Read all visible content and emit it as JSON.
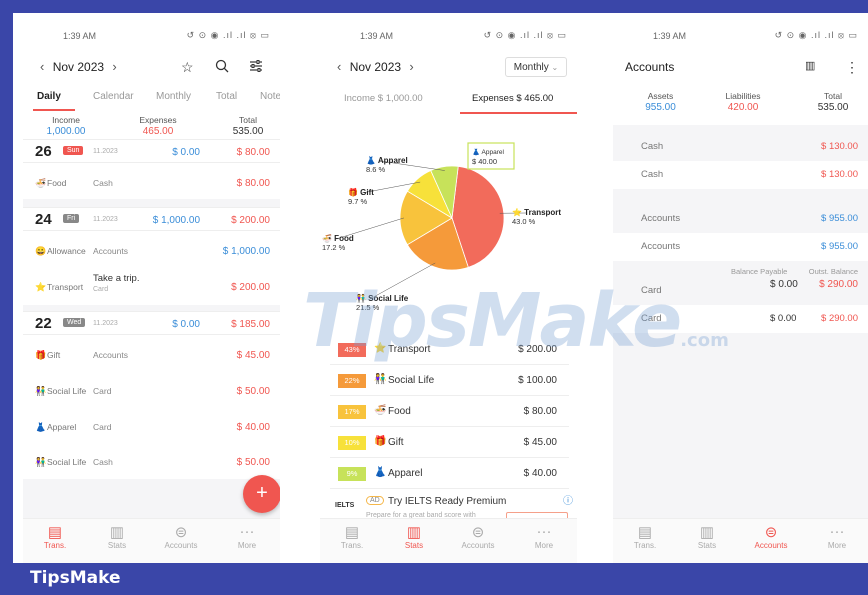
{
  "watermark": {
    "main": "TipsMake",
    "suffix": ".com"
  },
  "footer_brand": "TipsMake",
  "status": {
    "time": "1:39 AM",
    "icons": "↺ ⊙ ◉ .ıl .ıl ⦻ ▭"
  },
  "nav": {
    "trans": "Trans.",
    "stats": "Stats",
    "accounts": "Accounts",
    "more": "More"
  },
  "colors": {
    "accent": "#f05650",
    "income": "#3a8dd8",
    "brand_bg": "#3a46a8"
  },
  "trans": {
    "month": "Nov 2023",
    "tabs": [
      "Daily",
      "Calendar",
      "Monthly",
      "Total",
      "Note"
    ],
    "summary": {
      "income_label": "Income",
      "income": "1,000.00",
      "expenses_label": "Expenses",
      "expenses": "465.00",
      "total_label": "Total",
      "total": "535.00"
    },
    "days": [
      {
        "num": "26",
        "weekday": "Sun",
        "date": "11.2023",
        "income": "$ 0.00",
        "expense": "$ 80.00",
        "items": [
          {
            "icon": "food-icon",
            "glyph": "🍜",
            "category": "Food",
            "account": "Cash",
            "note": "",
            "sub": "",
            "amount": "$ 80.00"
          }
        ]
      },
      {
        "num": "24",
        "weekday": "Fri",
        "date": "11.2023",
        "income": "$ 1,000.00",
        "expense": "$ 200.00",
        "items": [
          {
            "icon": "allowance-icon",
            "glyph": "😀",
            "category": "Allowance",
            "account": "Accounts",
            "note": "",
            "sub": "",
            "amount": "$ 1,000.00"
          },
          {
            "icon": "transport-icon",
            "glyph": "⭐",
            "category": "Transport",
            "account": "",
            "note": "Take a trip.",
            "sub": "Card",
            "amount": "$ 200.00"
          }
        ]
      },
      {
        "num": "22",
        "weekday": "Wed",
        "date": "11.2023",
        "income": "$ 0.00",
        "expense": "$ 185.00",
        "items": [
          {
            "icon": "gift-icon",
            "glyph": "🎁",
            "category": "Gift",
            "account": "Accounts",
            "note": "",
            "sub": "",
            "amount": "$ 45.00"
          },
          {
            "icon": "social-life-icon",
            "glyph": "👫",
            "category": "Social Life",
            "account": "Card",
            "note": "",
            "sub": "",
            "amount": "$ 50.00"
          },
          {
            "icon": "apparel-icon",
            "glyph": "👗",
            "category": "Apparel",
            "account": "Card",
            "note": "",
            "sub": "",
            "amount": "$ 40.00"
          },
          {
            "icon": "social-life-icon",
            "glyph": "👫",
            "category": "Social Life",
            "account": "Cash",
            "note": "",
            "sub": "",
            "amount": "$ 50.00"
          }
        ]
      }
    ],
    "fab": "+"
  },
  "stats": {
    "month": "Nov 2023",
    "period": "Monthly",
    "income_tab": "Income  $ 1,000.00",
    "expenses_tab": "Expenses  $ 465.00",
    "tooltip": {
      "name": "Apparel",
      "amount": "$ 40.00"
    },
    "categories": [
      {
        "name": "Transport",
        "pct": "43%",
        "label_pct": "43.0 %",
        "amount": "$ 200.00",
        "color": "#f26b5b",
        "glyph": "⭐"
      },
      {
        "name": "Social Life",
        "pct": "22%",
        "label_pct": "21.5 %",
        "amount": "$ 100.00",
        "color": "#f59a3a",
        "glyph": "👫"
      },
      {
        "name": "Food",
        "pct": "17%",
        "label_pct": "17.2 %",
        "amount": "$ 80.00",
        "color": "#f8c33c",
        "glyph": "🍜"
      },
      {
        "name": "Gift",
        "pct": "10%",
        "label_pct": "9.7 %",
        "amount": "$ 45.00",
        "color": "#f7e13a",
        "glyph": "🎁"
      },
      {
        "name": "Apparel",
        "pct": "9%",
        "label_pct": "8.6 %",
        "amount": "$ 40.00",
        "color": "#c7e25a",
        "glyph": "👗"
      }
    ],
    "ad": {
      "logo": "IELTS",
      "badge": "AD",
      "title": "Try IELTS Ready Premium",
      "sub": "Prepare for a great band score with"
    }
  },
  "accounts": {
    "title": "Accounts",
    "summary": {
      "assets_label": "Assets",
      "assets": "955.00",
      "liabilities_label": "Liabilities",
      "liabilities": "420.00",
      "total_label": "Total",
      "total": "535.00"
    },
    "groups": [
      {
        "name": "Cash",
        "amount": "$ 130.00",
        "cls": "red",
        "rows": [
          {
            "name": "Cash",
            "amount": "$ 130.00",
            "cls": "red"
          }
        ]
      },
      {
        "name": "Accounts",
        "amount": "$ 955.00",
        "cls": "blue",
        "rows": [
          {
            "name": "Accounts",
            "amount": "$ 955.00",
            "cls": "blue"
          }
        ]
      }
    ],
    "card": {
      "name": "Card",
      "payable_label": "Balance Payable",
      "outst_label": "Outst. Balance",
      "payable": "$ 0.00",
      "outst": "$ 290.00",
      "row_name": "Card",
      "row_payable": "$ 0.00",
      "row_outst": "$ 290.00"
    }
  }
}
